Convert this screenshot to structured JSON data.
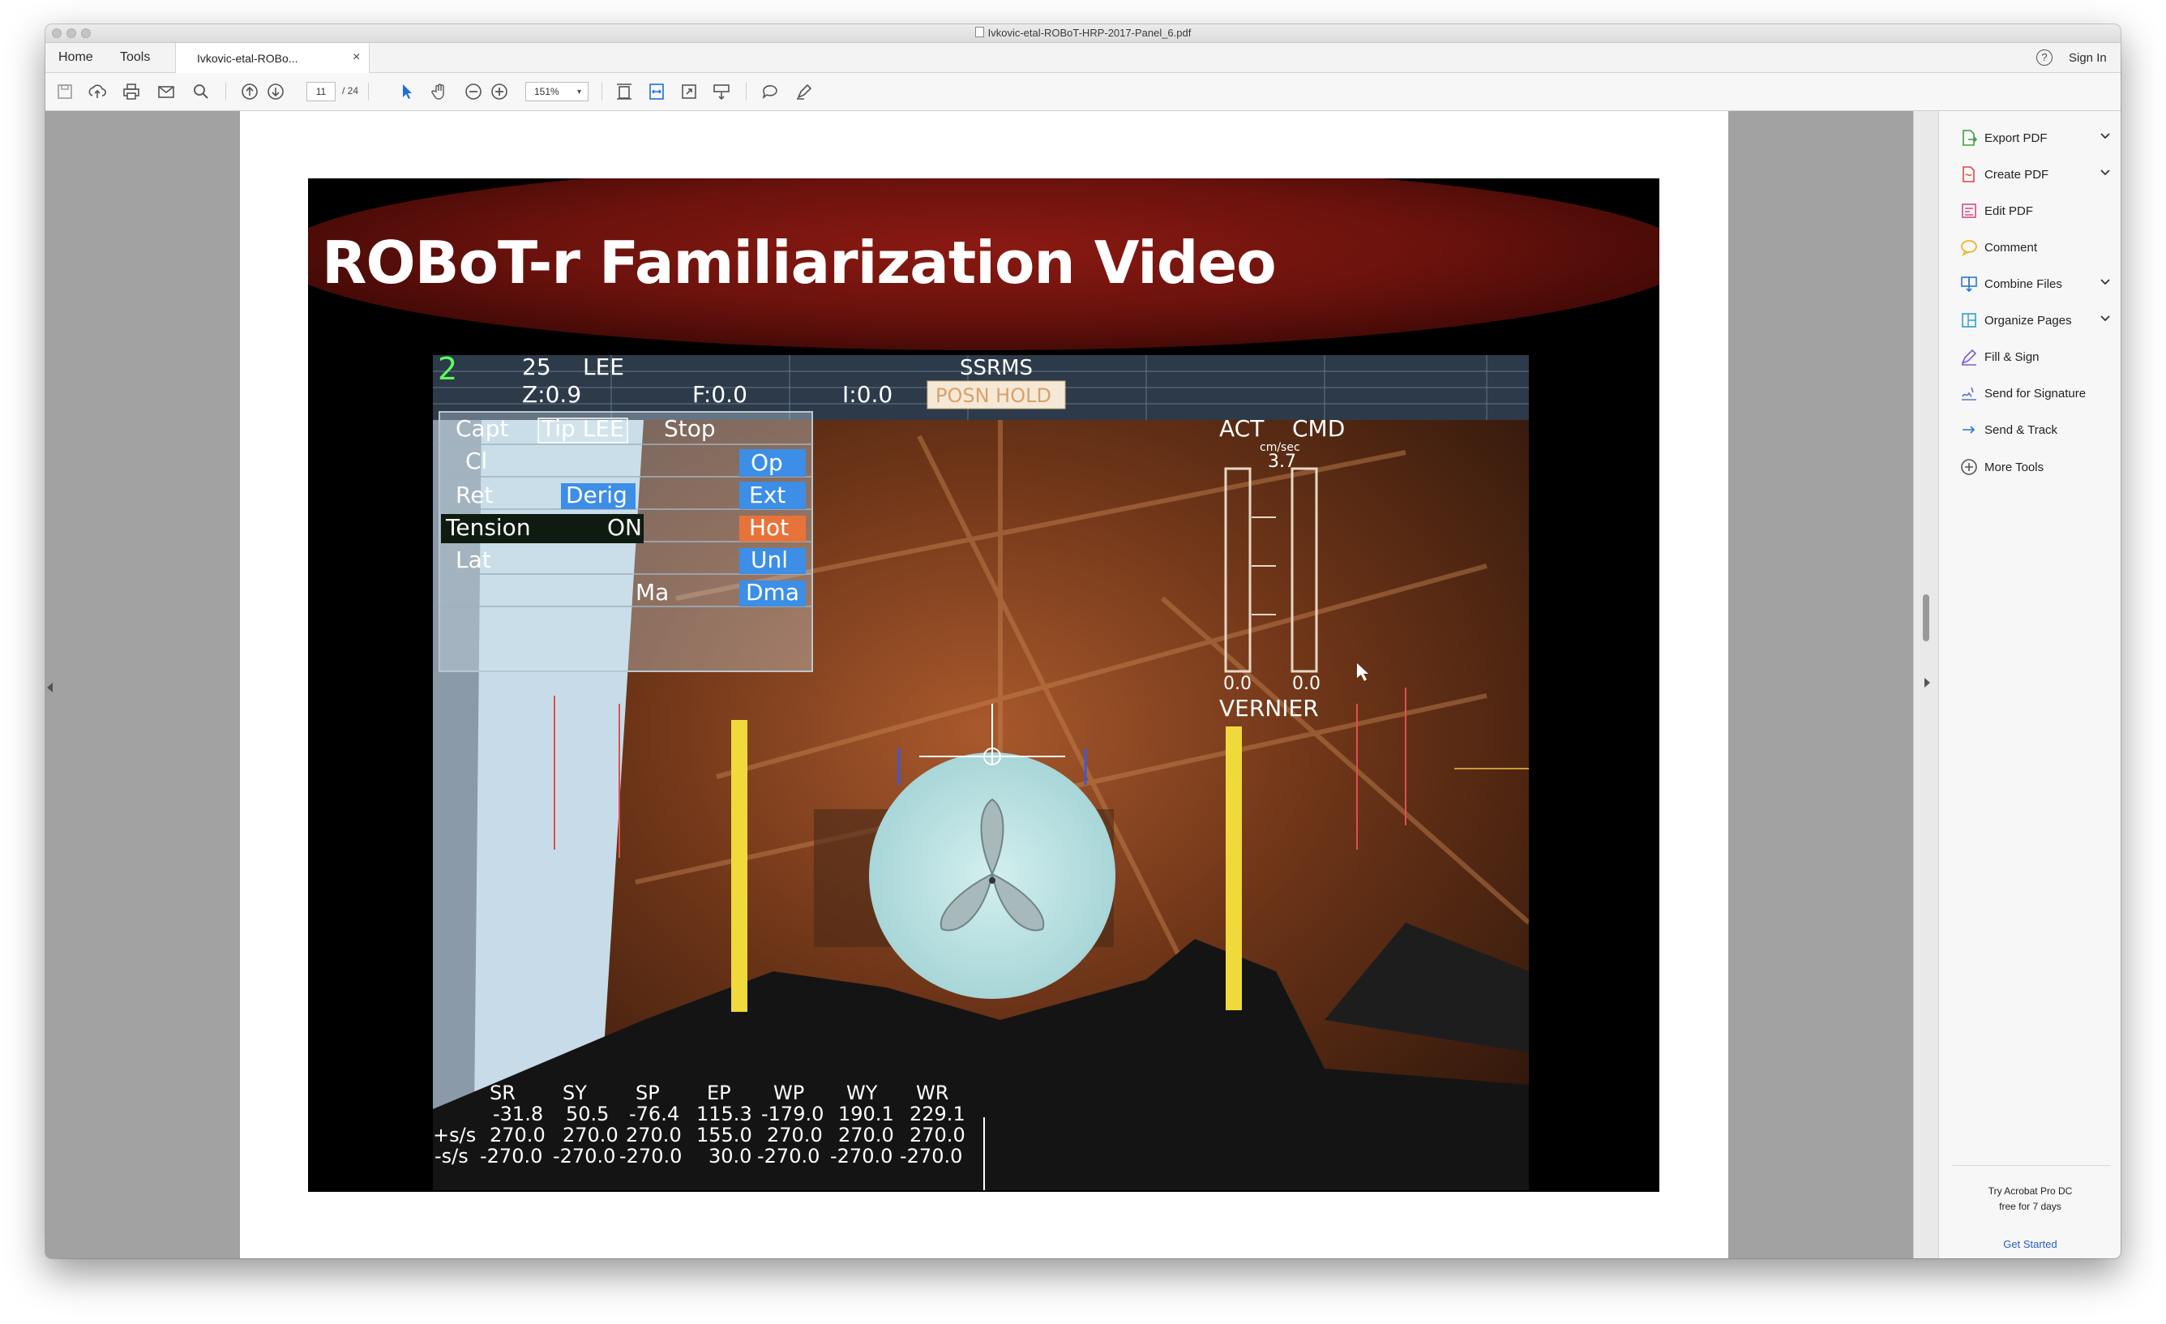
{
  "window": {
    "title": "Ivkovic-etal-ROBoT-HRP-2017-Panel_6.pdf"
  },
  "menubar": {
    "home": "Home",
    "tools": "Tools",
    "tab_label": "Ivkovic-etal-ROBo...",
    "tab_close": "×",
    "sign_in": "Sign In",
    "help": "?"
  },
  "toolbar": {
    "current_page": "11",
    "total_pages": "/ 24",
    "zoom": "151%"
  },
  "slide": {
    "title": "ROBoT-r Familiarization Video"
  },
  "video_hud": {
    "top_left_digit": "2",
    "top_a": "25",
    "top_b": "LEE",
    "z_readout": "Z:0.9",
    "f_readout": "F:0.0",
    "i_readout": "I:0.0",
    "mode_title": "SSRMS",
    "mode_status": "POSN HOLD",
    "table": {
      "capt": "Capt",
      "tip_lee": "Tip LEE",
      "stop": "Stop",
      "cl": "Cl",
      "op": "Op",
      "ret": "Ret",
      "derig": "Derig",
      "ext": "Ext",
      "tension": "Tension",
      "on": "ON",
      "hot": "Hot",
      "lat": "Lat",
      "unl": "Unl",
      "ma": "Ma",
      "dma": "Dma"
    },
    "gauge": {
      "act": "ACT",
      "cmd": "CMD",
      "unit": "cm/sec",
      "value": "3.7",
      "act_val": "0.0",
      "cmd_val": "0.0",
      "mode": "VERNIER"
    },
    "joints": {
      "headers": [
        "SR",
        "SY",
        "SP",
        "EP",
        "WP",
        "WY",
        "WR"
      ],
      "row1_label": "",
      "row1": [
        "-31.8",
        "50.5",
        "-76.4",
        "115.3",
        "-179.0",
        "190.1",
        "229.1"
      ],
      "row2_label": "+s/s",
      "row2": [
        "270.0",
        "270.0",
        "270.0",
        "155.0",
        "270.0",
        "270.0",
        "270.0"
      ],
      "row3_label": "-s/s",
      "row3": [
        "-270.0",
        "-270.0",
        "-270.0",
        "30.0",
        "-270.0",
        "-270.0",
        "-270.0"
      ]
    }
  },
  "tools": [
    {
      "label": "Export PDF",
      "icon": "export-pdf-icon",
      "color": "#3f9e4b",
      "chevron": true
    },
    {
      "label": "Create PDF",
      "icon": "create-pdf-icon",
      "color": "#e0473f",
      "chevron": true
    },
    {
      "label": "Edit PDF",
      "icon": "edit-pdf-icon",
      "color": "#d44a8b",
      "chevron": false
    },
    {
      "label": "Comment",
      "icon": "comment-icon",
      "color": "#e8b624",
      "chevron": false
    },
    {
      "label": "Combine Files",
      "icon": "combine-files-icon",
      "color": "#2c77d1",
      "chevron": true
    },
    {
      "label": "Organize Pages",
      "icon": "organize-pages-icon",
      "color": "#2c9fd1",
      "chevron": true
    },
    {
      "label": "Fill & Sign",
      "icon": "fill-sign-icon",
      "color": "#7a5bd6",
      "chevron": false
    },
    {
      "label": "Send for Signature",
      "icon": "send-signature-icon",
      "color": "#5a6fd6",
      "chevron": false
    },
    {
      "label": "Send & Track",
      "icon": "send-track-icon",
      "color": "#2c77d1",
      "chevron": false
    },
    {
      "label": "More Tools",
      "icon": "more-tools-icon",
      "color": "#555555",
      "chevron": false
    }
  ],
  "promo": {
    "line1": "Try Acrobat Pro DC",
    "line2": "free for 7 days",
    "cta": "Get Started"
  }
}
